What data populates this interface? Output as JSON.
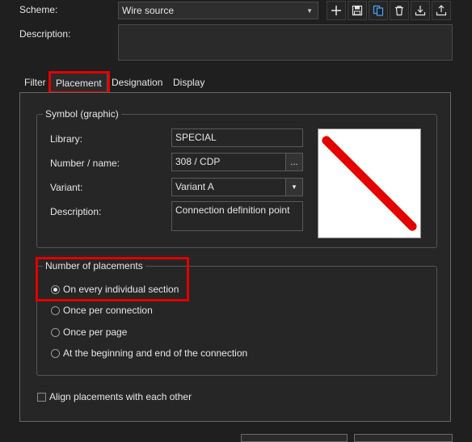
{
  "header": {
    "scheme_label": "Scheme:",
    "scheme_value": "Wire source",
    "description_label": "Description:",
    "toolbar": [
      {
        "icon": "plus-icon"
      },
      {
        "icon": "save-icon"
      },
      {
        "icon": "copy-icon"
      },
      {
        "icon": "delete-icon"
      },
      {
        "icon": "import-icon"
      },
      {
        "icon": "export-icon"
      }
    ]
  },
  "tabs": [
    {
      "label": "Filter",
      "active": false
    },
    {
      "label": "Placement",
      "active": true
    },
    {
      "label": "Designation",
      "active": false
    },
    {
      "label": "Display",
      "active": false
    }
  ],
  "symbol": {
    "group_title": "Symbol (graphic)",
    "library_label": "Library:",
    "library_value": "SPECIAL",
    "number_label": "Number / name:",
    "number_value": "308 / CDP",
    "browse_label": "...",
    "variant_label": "Variant:",
    "variant_value": "Variant A",
    "description_label": "Description:",
    "description_value": "Connection definition point",
    "preview_color": "#e30000"
  },
  "placements": {
    "group_title": "Number of placements",
    "options": [
      {
        "label": "On every individual section",
        "checked": true
      },
      {
        "label": "Once per connection",
        "checked": false
      },
      {
        "label": "Once per page",
        "checked": false
      },
      {
        "label": "At the beginning and end of the connection",
        "checked": false
      }
    ]
  },
  "align_checkbox": {
    "label": "Align placements with each other",
    "checked": false
  },
  "highlight_color": "#e30000"
}
